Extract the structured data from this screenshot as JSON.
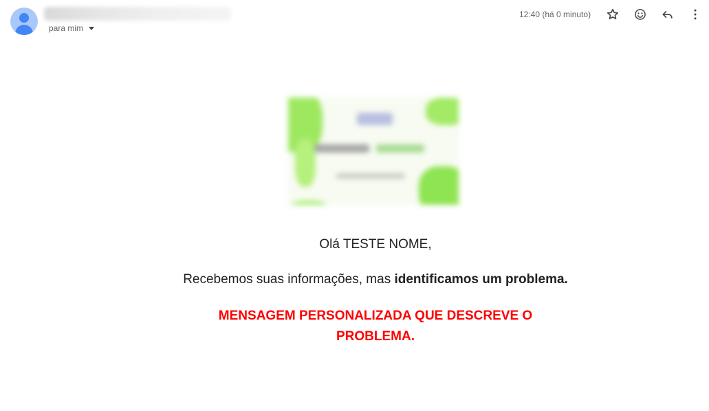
{
  "header": {
    "recipient_label": "para mim",
    "timestamp": "12:40 (há 0 minuto)",
    "icons": [
      "star-icon",
      "emoji-icon",
      "reply-icon",
      "more-vert-icon"
    ]
  },
  "body": {
    "greeting": "Olá TESTE NOME,",
    "message_prefix": "Recebemos suas informações, mas ",
    "message_bold": "identificamos um problema.",
    "problem_message": "MENSAGEM PERSONALIZADA QUE DESCREVE O PROBLEMA."
  },
  "colors": {
    "problem_text": "#ff0000",
    "avatar_bg": "#a8c7fa",
    "avatar_fg": "#4285f4"
  }
}
